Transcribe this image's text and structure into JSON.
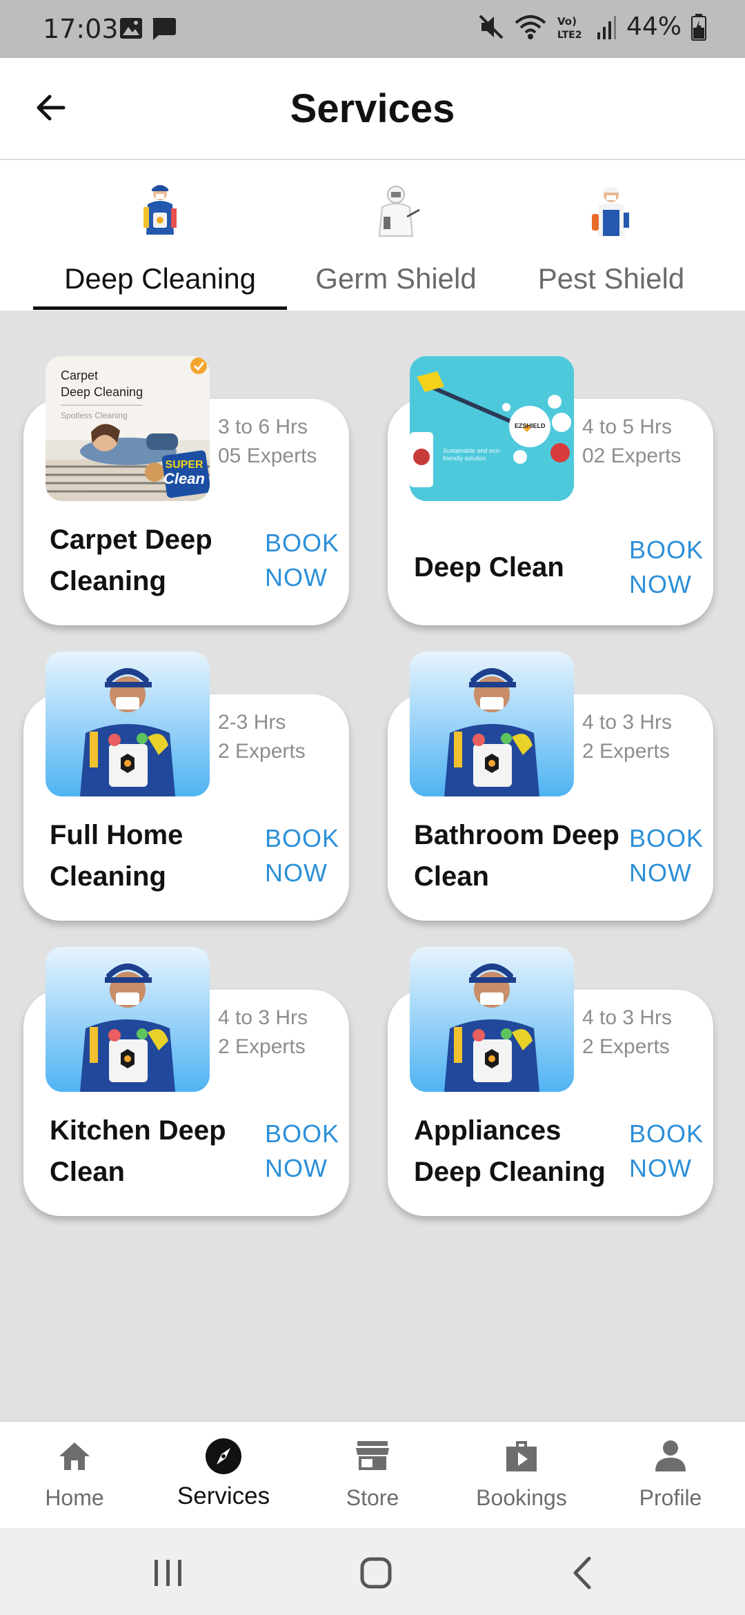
{
  "status_bar": {
    "time": "17:03",
    "battery": "44%",
    "icons": [
      "gallery-icon",
      "message-icon",
      "mute-icon",
      "wifi-icon",
      "volte-icon",
      "signal-icon",
      "battery-icon"
    ]
  },
  "header": {
    "title": "Services",
    "back_icon": "arrow-left-icon"
  },
  "tabs": [
    {
      "label": "Deep Cleaning",
      "active": true
    },
    {
      "label": "Germ Shield",
      "active": false
    },
    {
      "label": "Pest Shield",
      "active": false
    }
  ],
  "services": [
    {
      "name_line1": "Carpet Deep",
      "name_line2": "Cleaning",
      "duration": "3 to 6 Hrs",
      "experts": "05 Experts",
      "book_line1": "BOOK",
      "book_line2": "NOW",
      "image_text": {
        "title_line1": "Carpet",
        "title_line2": "Deep Cleaning",
        "subtitle": "Spotless Cleaning",
        "badge_line1": "SUPER",
        "badge_line2": "Clean"
      }
    },
    {
      "name_line1": "Deep Clean",
      "name_line2": "",
      "duration": "4 to 5 Hrs",
      "experts": "02 Experts",
      "book_line1": "BOOK",
      "book_line2": "NOW",
      "image_text": {
        "brand": "EZSHIELD",
        "tagline": "Sustainable and eco-friendly solution"
      }
    },
    {
      "name_line1": "Full Home",
      "name_line2": "Cleaning",
      "duration": "2-3 Hrs",
      "experts": "2 Experts",
      "book_line1": "BOOK",
      "book_line2": "NOW"
    },
    {
      "name_line1": "Bathroom Deep",
      "name_line2": "Clean",
      "duration": "4 to 3 Hrs",
      "experts": "2 Experts",
      "book_line1": "BOOK",
      "book_line2": "NOW"
    },
    {
      "name_line1": "Kitchen Deep",
      "name_line2": "Clean",
      "duration": "4 to 3 Hrs",
      "experts": "2 Experts",
      "book_line1": "BOOK",
      "book_line2": "NOW"
    },
    {
      "name_line1": "Appliances",
      "name_line2": "Deep Cleaning",
      "duration": "4 to 3 Hrs",
      "experts": "2 Experts",
      "book_line1": "BOOK",
      "book_line2": "NOW"
    }
  ],
  "bottom_nav": [
    {
      "label": "Home",
      "icon": "home-icon",
      "active": false
    },
    {
      "label": "Services",
      "icon": "compass-icon",
      "active": true
    },
    {
      "label": "Store",
      "icon": "store-icon",
      "active": false
    },
    {
      "label": "Bookings",
      "icon": "briefcase-play-icon",
      "active": false
    },
    {
      "label": "Profile",
      "icon": "person-icon",
      "active": false
    }
  ],
  "colors": {
    "accent": "#2b8fd9",
    "background": "#e1e1e1",
    "status_bar": "#bdbdbd"
  }
}
